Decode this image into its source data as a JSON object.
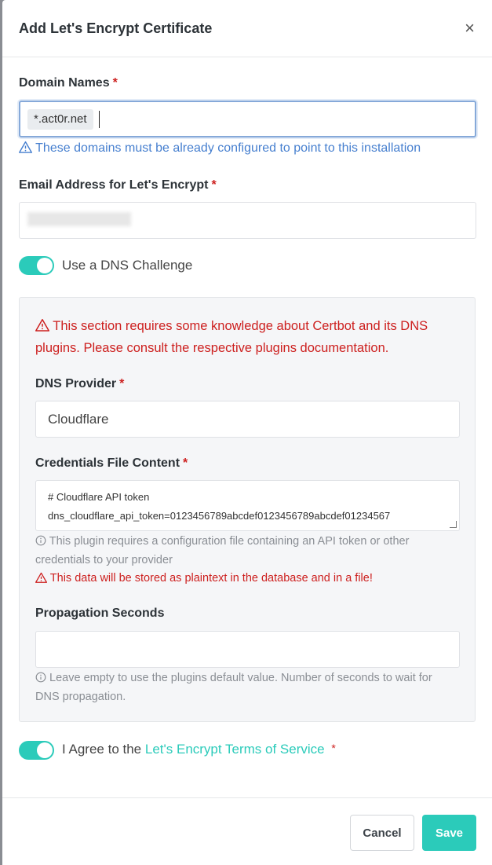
{
  "modal": {
    "title": "Add Let's Encrypt Certificate",
    "close": "×"
  },
  "domain": {
    "label": "Domain Names",
    "required": "*",
    "chip": "*.act0r.net",
    "hint": "These domains must be already configured to point to this installation"
  },
  "email": {
    "label": "Email Address for Let's Encrypt",
    "required": "*"
  },
  "dns_toggle": {
    "label": "Use a DNS Challenge",
    "on": true
  },
  "dns": {
    "warning": "This section requires some knowledge about Certbot and its DNS plugins. Please consult the respective plugins documentation.",
    "provider_label": "DNS Provider",
    "provider_required": "*",
    "provider_value": "Cloudflare",
    "credentials_label": "Credentials File Content",
    "credentials_required": "*",
    "credentials_line1": "# Cloudflare API token",
    "credentials_line2": "dns_cloudflare_api_token=0123456789abcdef0123456789abcdef01234567",
    "credentials_info": "This plugin requires a configuration file containing an API token or other credentials to your provider",
    "credentials_warning": "This data will be stored as plaintext in the database and in a file!",
    "propagation_label": "Propagation Seconds",
    "propagation_value": "",
    "propagation_info": "Leave empty to use the plugins default value. Number of seconds to wait for DNS propagation."
  },
  "agree": {
    "prefix": "I Agree to the",
    "link": "Let's Encrypt Terms of Service",
    "required": "*",
    "on": true
  },
  "footer": {
    "cancel": "Cancel",
    "save": "Save"
  },
  "colors": {
    "accent": "#2bcbba",
    "danger": "#cd201f",
    "info": "#467fcf"
  }
}
